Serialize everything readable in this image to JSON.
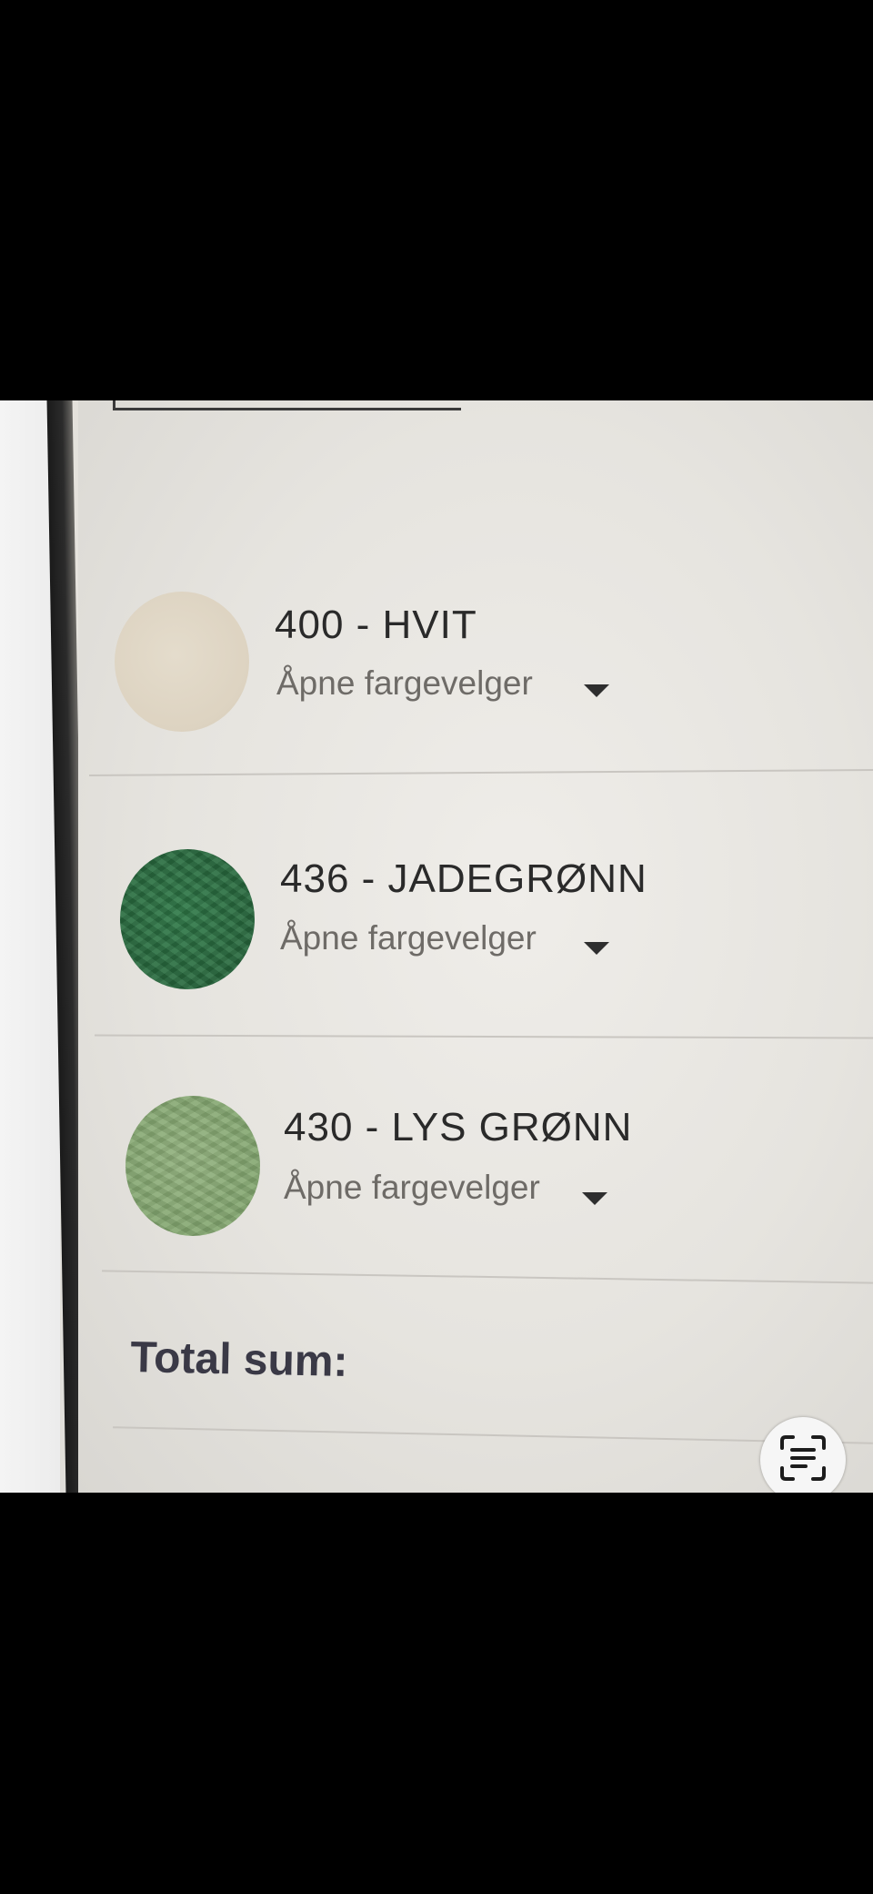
{
  "colors": [
    {
      "name": "400 - HVIT",
      "picker_label": "Åpne fargevelger",
      "swatch_color": "#ddd3c1"
    },
    {
      "name": "436 - JADEGRØNN",
      "picker_label": "Åpne fargevelger",
      "swatch_color": "#28693e"
    },
    {
      "name": "430 - LYS GRØNN",
      "picker_label": "Åpne fargevelger",
      "swatch_color": "#82a56e"
    }
  ],
  "summary": {
    "total_label": "Total sum:"
  },
  "overlay": {
    "scan_icon": "text-scan-icon"
  }
}
